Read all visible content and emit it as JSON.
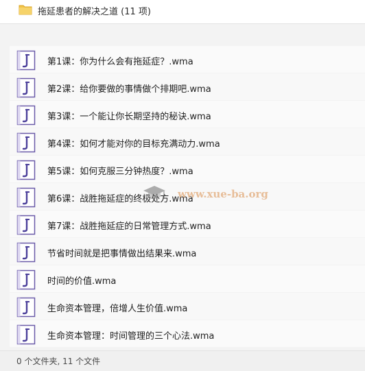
{
  "header": {
    "title": "拖延患者的解决之道 (11 项)",
    "folder_icon": "folder-icon"
  },
  "files": [
    {
      "name": "第1课：你为什么会有拖延症？.wma",
      "icon": "audio-file-icon"
    },
    {
      "name": "第2课：给你要做的事情做个排期吧.wma",
      "icon": "audio-file-icon"
    },
    {
      "name": "第3课：一个能让你长期坚持的秘诀.wma",
      "icon": "audio-file-icon"
    },
    {
      "name": "第4课：如何才能对你的目标充满动力.wma",
      "icon": "audio-file-icon"
    },
    {
      "name": "第5课：如何克服三分钟热度？.wma",
      "icon": "audio-file-icon"
    },
    {
      "name": "第6课：战胜拖延症的终极处方.wma",
      "icon": "audio-file-icon"
    },
    {
      "name": "第7课：战胜拖延症的日常管理方式.wma",
      "icon": "audio-file-icon"
    },
    {
      "name": "节省时间就是把事情做出结果来.wma",
      "icon": "audio-file-icon"
    },
    {
      "name": "时间的价值.wma",
      "icon": "audio-file-icon"
    },
    {
      "name": "生命资本管理，倍增人生价值.wma",
      "icon": "audio-file-icon"
    },
    {
      "name": "生命资本管理：时间管理的三个心法.wma",
      "icon": "audio-file-icon"
    }
  ],
  "status": {
    "summary": "0 个文件夹, 11 个文件"
  },
  "watermark": {
    "text": "www.xue-ba.org"
  },
  "colors": {
    "folder": "#f2c447",
    "file_icon_border": "#6a5aa8",
    "file_icon_glyph": "#4b3f9a",
    "watermark": "#e2aa78"
  }
}
